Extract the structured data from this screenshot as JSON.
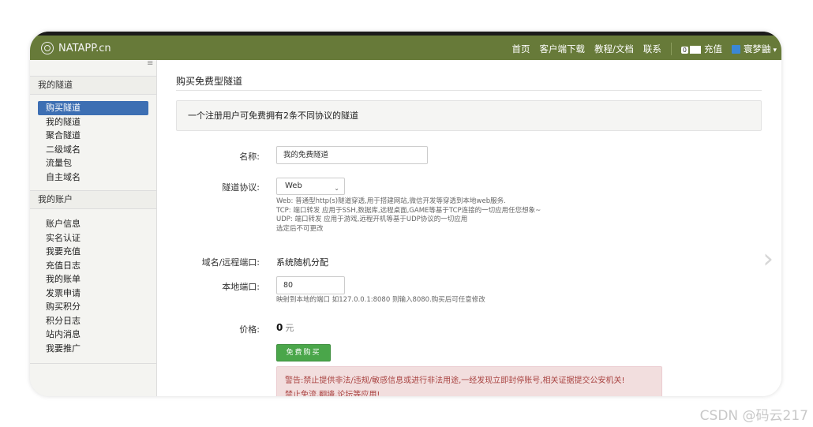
{
  "navbar": {
    "brand": "NATAPP.cn",
    "links": [
      "首页",
      "客户端下载",
      "教程/文档",
      "联系"
    ],
    "recharge_badge": "0",
    "recharge_label": "充值",
    "user_name": "寰梦鼬"
  },
  "sidebar": {
    "tunnels_head": "我的隧道",
    "tunnel_items": [
      "购买隧道",
      "我的隧道",
      "聚合隧道",
      "二级域名",
      "流量包",
      "自主域名"
    ],
    "account_head": "我的账户",
    "account_items": [
      "账户信息",
      "实名认证",
      "我要充值",
      "充值日志",
      "我的账单",
      "发票申请",
      "购买积分",
      "积分日志",
      "站内消息",
      "我要推广"
    ]
  },
  "main": {
    "page_title": "购买免费型隧道",
    "notice": "一个注册用户可免费拥有2条不同协议的隧道",
    "name_label": "名称:",
    "name_value": "我的免费隧道",
    "protocol_label": "隧道协议:",
    "protocol_value": "Web",
    "protocol_help": [
      "Web: 普通型http(s)隧道穿透,用于搭建网站,微信开发等穿透到本地web服务.",
      "TCP: 端口转发 应用于SSH,数据库,远程桌面,GAME等基于TCP连接的一切应用任您想象~",
      "UDP: 端口转发 应用于游戏,远程开机等基于UDP协议的一切应用",
      "选定后不可更改"
    ],
    "domain_label": "域名/远程端口:",
    "domain_value": "系统随机分配",
    "port_label": "本地端口:",
    "port_value": "80",
    "port_help": "映射到本地的端口 如127.0.0.1:8080 则输入8080.购买后可任意修改",
    "price_label": "价格:",
    "price_value": "0",
    "price_unit": "元",
    "buy_button": "免费购买",
    "warning_line1": "警告:禁止提供非法/违规/敏感信息或进行非法用途,一经发现立即封停账号,相关证据提交公安机关!",
    "warning_line2": "禁止免流,翻墙,论坛等应用!"
  },
  "watermark": "CSDN @码云217",
  "colors": {
    "navbar": "#677a39",
    "active_menu": "#3d6fb3",
    "buy_button": "#4aa64a"
  }
}
